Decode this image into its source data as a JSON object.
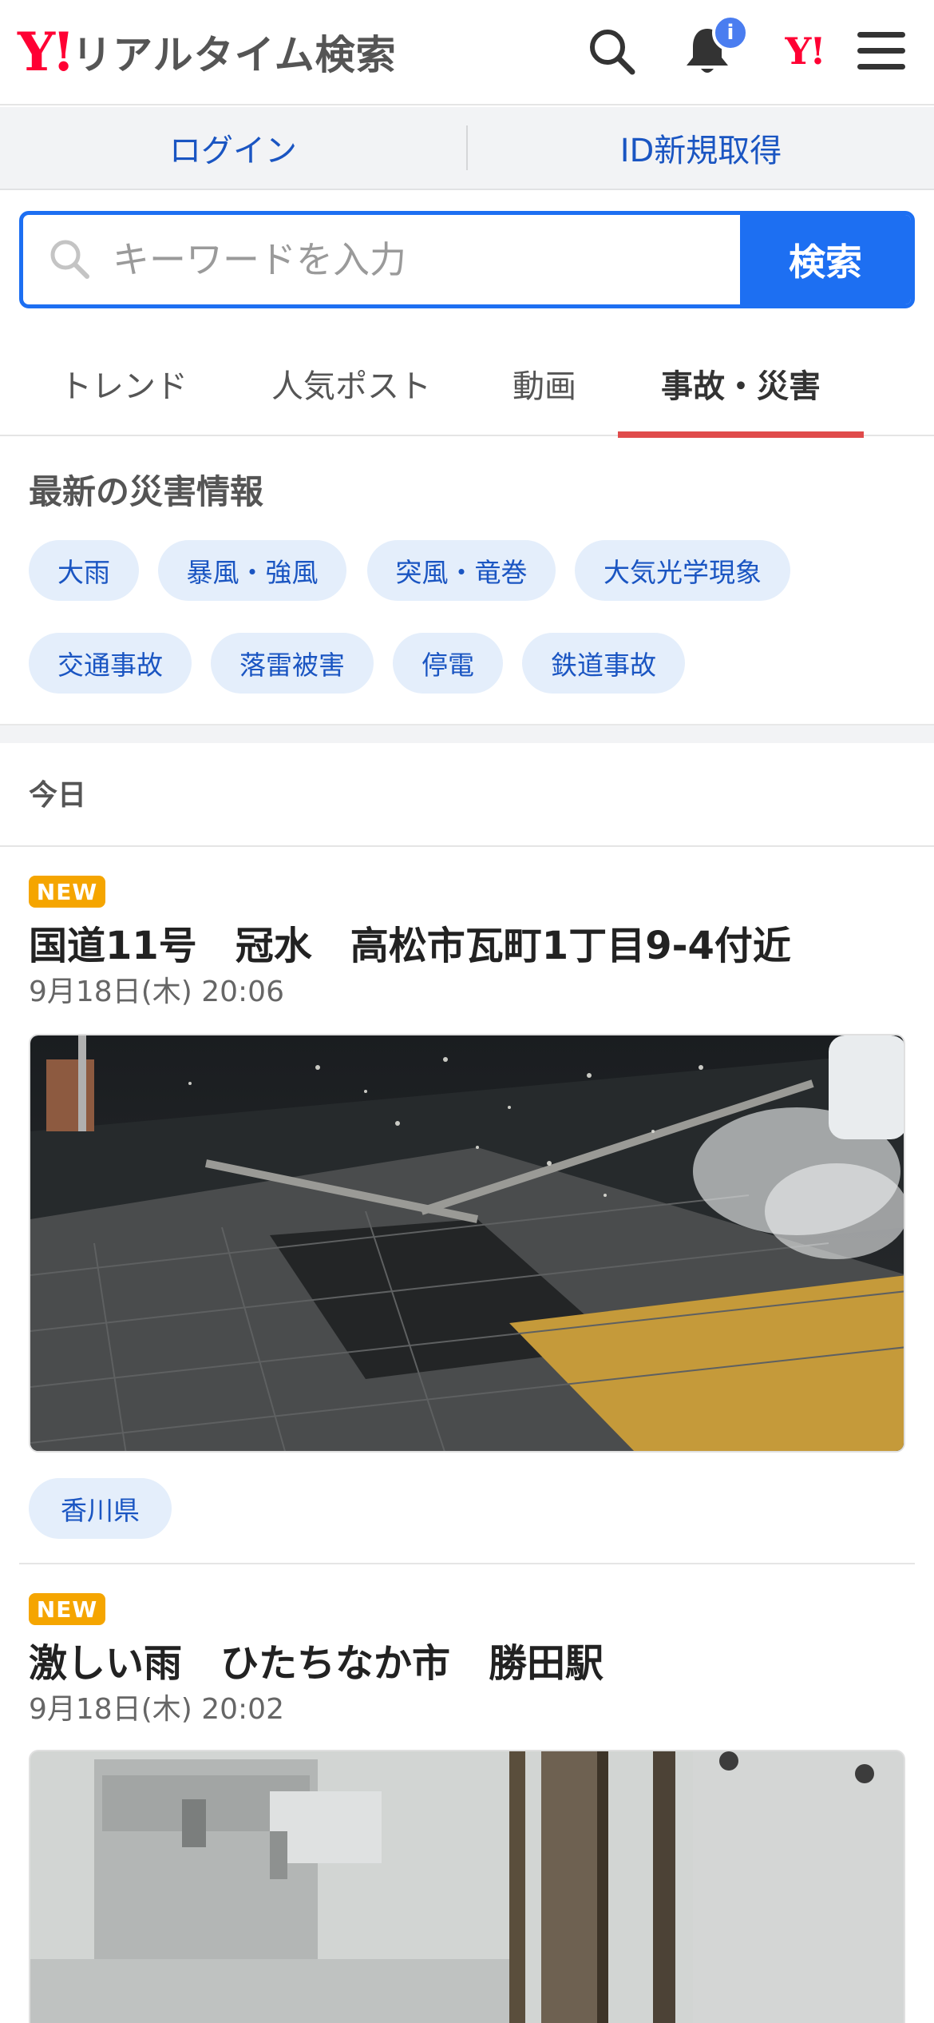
{
  "header": {
    "logo_mark": "Y!",
    "logo_text": "リアルタイム検索",
    "notification_badge": "i",
    "yahoo_mark": "Y!"
  },
  "loginbar": {
    "login": "ログイン",
    "signup": "ID新規取得"
  },
  "search": {
    "placeholder": "キーワードを入力",
    "button": "検索"
  },
  "tabs": [
    "トレンド",
    "人気ポスト",
    "動画",
    "事故・災害"
  ],
  "disaster_info": {
    "title": "最新の災害情報",
    "chips": [
      "大雨",
      "暴風・強風",
      "突風・竜巻",
      "大気光学現象",
      "交通事故",
      "落雷被害",
      "停電",
      "鉄道事故"
    ]
  },
  "date_heading": "今日",
  "posts": [
    {
      "badge": "NEW",
      "title": "国道11号　冠水　高松市瓦町1丁目9-4付近",
      "time": "9月18日(木) 20:06",
      "location": "香川県"
    },
    {
      "badge": "NEW",
      "title": "激しい雨　ひたちなか市　勝田駅",
      "time": "9月18日(木) 20:02"
    }
  ],
  "colors": {
    "accent": "#1d6ff2",
    "brand": "#ff0033",
    "active_tab": "#e04b4b",
    "new_badge": "#f5a500"
  }
}
